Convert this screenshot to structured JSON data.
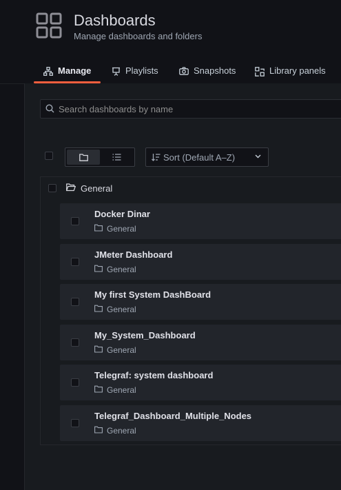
{
  "header": {
    "title": "Dashboards",
    "subtitle": "Manage dashboards and folders",
    "icon": "dashboards-grid-icon"
  },
  "tabs": [
    {
      "label": "Manage",
      "icon": "sitemap-icon",
      "active": true
    },
    {
      "label": "Playlists",
      "icon": "presentation-icon",
      "active": false
    },
    {
      "label": "Snapshots",
      "icon": "camera-icon",
      "active": false
    },
    {
      "label": "Library panels",
      "icon": "library-panel-icon",
      "active": false
    }
  ],
  "search": {
    "placeholder": "Search dashboards by name",
    "value": ""
  },
  "toolbar": {
    "view_modes": [
      "folder-view",
      "list-view"
    ],
    "active_view": "folder-view",
    "sort_label": "Sort (Default A–Z)"
  },
  "folder": {
    "name": "General",
    "dashboards": [
      {
        "title": "Docker Dinar",
        "folder": "General"
      },
      {
        "title": "JMeter Dashboard",
        "folder": "General"
      },
      {
        "title": "My first System DashBoard",
        "folder": "General"
      },
      {
        "title": "My_System_Dashboard",
        "folder": "General"
      },
      {
        "title": "Telegraf: system dashboard",
        "folder": "General"
      },
      {
        "title": "Telegraf_Dashboard_Multiple_Nodes",
        "folder": "General"
      }
    ]
  },
  "colors": {
    "background": "#111217",
    "panel": "#181b1f",
    "row": "#22252b",
    "accent": "#f55f3e"
  }
}
